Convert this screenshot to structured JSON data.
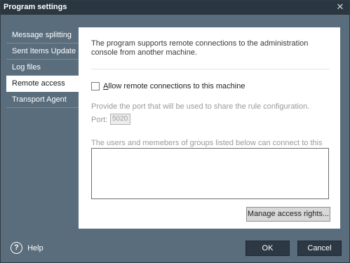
{
  "window": {
    "title": "Program settings",
    "close_glyph": "✕"
  },
  "sidebar": {
    "items": [
      {
        "label": "Message splitting",
        "selected": false
      },
      {
        "label": "Sent Items Update",
        "selected": false
      },
      {
        "label": "Log files",
        "selected": false
      },
      {
        "label": "Remote access",
        "selected": true
      },
      {
        "label": "Transport Agent",
        "selected": false
      }
    ]
  },
  "main": {
    "intro_text": "The program supports remote connections to the administration console from another machine.",
    "allow_remote": {
      "label_prefix": "A",
      "label_rest": "llow remote connections to this machine",
      "checked": false
    },
    "port_description": "Provide the port that will be used to share the rule configuration.",
    "port": {
      "label": "Port:",
      "value": "5020"
    },
    "users_description": "The users and memebers of groups listed below can connect to this installation:",
    "users_list": [],
    "manage_button": "Manage access rights..."
  },
  "footer": {
    "help_icon_glyph": "?",
    "help_label": "Help",
    "ok_label": "OK",
    "cancel_label": "Cancel"
  },
  "colors": {
    "window_bg": "#5a6d7c",
    "titlebar_bg": "#2a3640",
    "button_bg": "#2c3844"
  }
}
